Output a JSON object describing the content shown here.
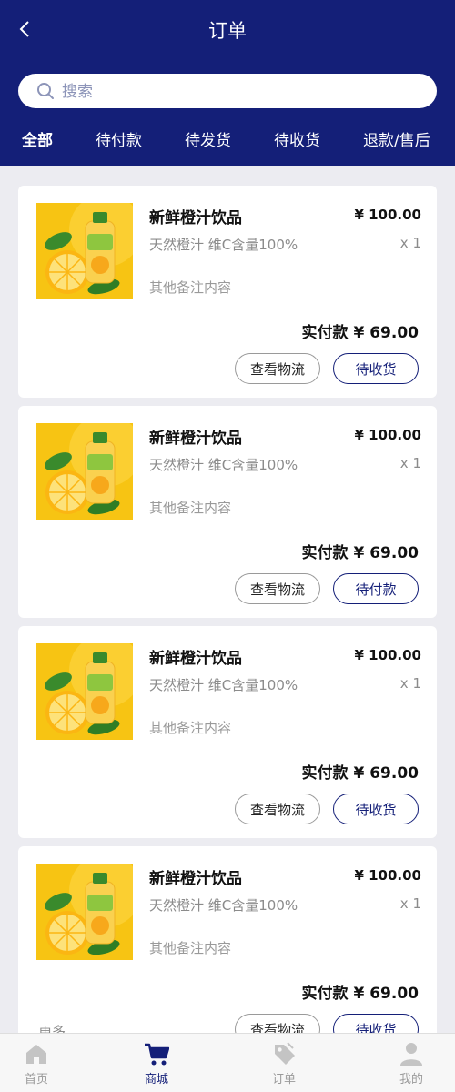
{
  "header": {
    "title": "订单"
  },
  "search": {
    "placeholder": "搜索"
  },
  "tabs": [
    {
      "label": "全部",
      "active": true
    },
    {
      "label": "待付款"
    },
    {
      "label": "待发货"
    },
    {
      "label": "待收货"
    },
    {
      "label": "退款/售后"
    }
  ],
  "orders": [
    {
      "name": "新鲜橙汁饮品",
      "price": "¥ 100.00",
      "spec": "天然橙汁 维C含量100%",
      "qty": "x 1",
      "note": "其他备注内容",
      "paid": "实付款 ¥ 69.00",
      "logistics_label": "查看物流",
      "status_label": "待收货"
    },
    {
      "name": "新鲜橙汁饮品",
      "price": "¥ 100.00",
      "spec": "天然橙汁 维C含量100%",
      "qty": "x 1",
      "note": "其他备注内容",
      "paid": "实付款 ¥ 69.00",
      "logistics_label": "查看物流",
      "status_label": "待付款"
    },
    {
      "name": "新鲜橙汁饮品",
      "price": "¥ 100.00",
      "spec": "天然橙汁 维C含量100%",
      "qty": "x 1",
      "note": "其他备注内容",
      "paid": "实付款 ¥ 69.00",
      "logistics_label": "查看物流",
      "status_label": "待收货"
    },
    {
      "name": "新鲜橙汁饮品",
      "price": "¥ 100.00",
      "spec": "天然橙汁 维C含量100%",
      "qty": "x 1",
      "note": "其他备注内容",
      "paid": "实付款 ¥ 69.00",
      "logistics_label": "查看物流",
      "status_label": "待收货",
      "more": "更多"
    }
  ],
  "tabbar": [
    {
      "label": "首页",
      "icon": "home-icon"
    },
    {
      "label": "商城",
      "icon": "cart-icon",
      "active": true
    },
    {
      "label": "订单",
      "icon": "tag-icon"
    },
    {
      "label": "我的",
      "icon": "user-icon"
    }
  ],
  "colors": {
    "primary": "#141f78",
    "background": "#ececf1",
    "muted": "#8b8b8b"
  }
}
